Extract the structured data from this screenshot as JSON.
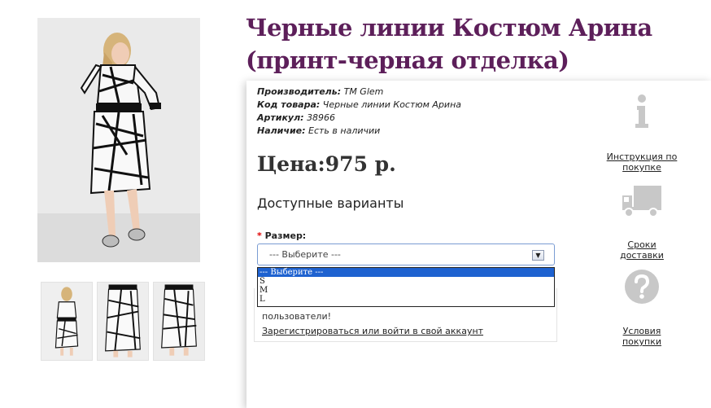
{
  "product": {
    "title": "Черные линии Костюм Арина (принт-черная отделка)",
    "specs": [
      {
        "label": "Производитель:",
        "value": "ТМ Glem"
      },
      {
        "label": "Код товара:",
        "value": "Черные линии Костюм Арина"
      },
      {
        "label": "Артикул:",
        "value": "38966"
      },
      {
        "label": "Наличие:",
        "value": "Есть в наличии"
      }
    ],
    "price": "Цена:975 р."
  },
  "options": {
    "heading": "Доступные варианты",
    "size_label": "Размер:",
    "required_mark": "*",
    "select_value": "--- Выберите ---",
    "dropdown_options": [
      "--- Выберите ---",
      "S",
      "M",
      "L"
    ],
    "selected_index": 0
  },
  "notice": {
    "text": "пользователи!",
    "link": "Зарегистрироваться или войти в свой аккаунт"
  },
  "side_links": {
    "instructions": "Инструкция по покупке",
    "delivery": "Сроки доставки",
    "terms": "Условия покупки"
  },
  "icons": {
    "info": "info-icon",
    "delivery": "truck-icon",
    "terms": "question-icon",
    "dropdown_arrow": "triangle-down-icon"
  },
  "colors": {
    "title": "#5d1f5a",
    "required": "#e00000",
    "dropdown_highlight": "#1e62d0",
    "icon_gray": "#c8c8c8"
  }
}
